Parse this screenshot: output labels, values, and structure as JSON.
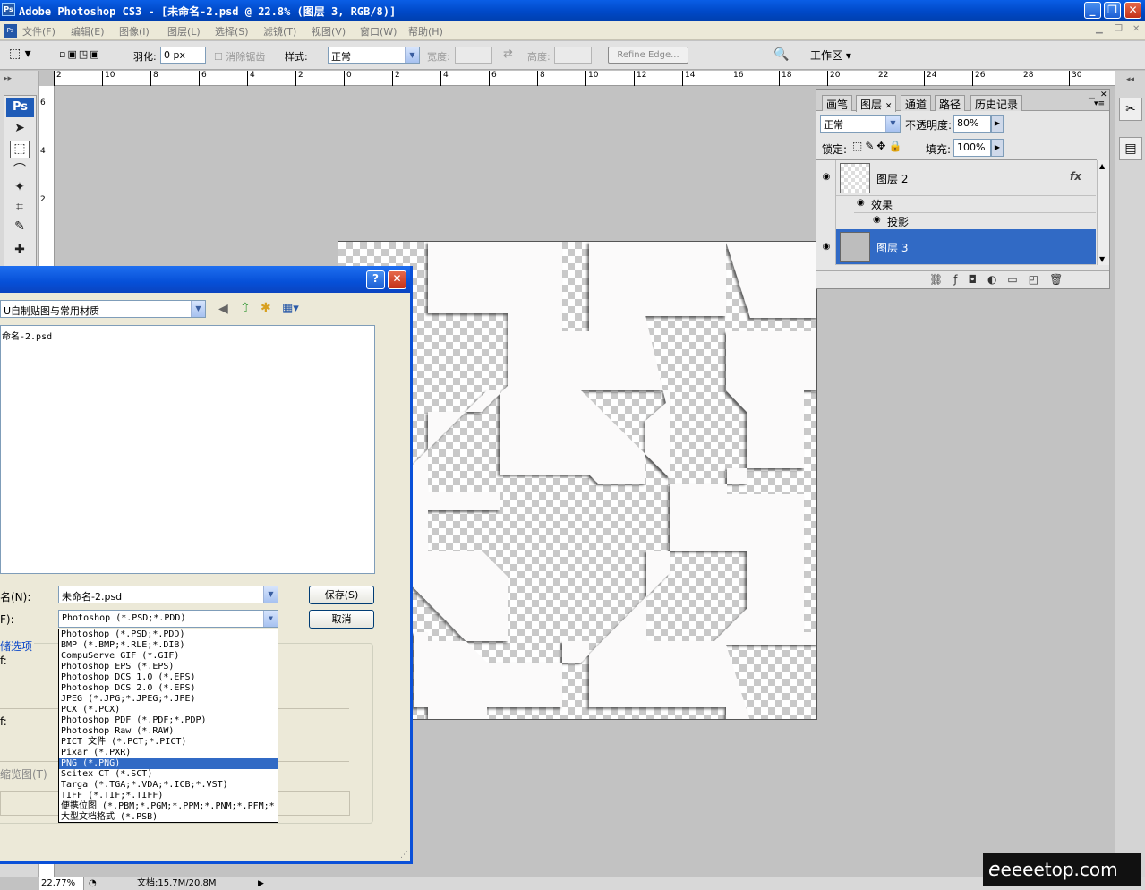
{
  "window": {
    "title": "Adobe Photoshop CS3 - [未命名-2.psd @ 22.8% (图层 3, RGB/8)]",
    "app_icon": "Ps"
  },
  "menu": {
    "items": [
      "文件(F)",
      "编辑(E)",
      "图像(I)",
      "图层(L)",
      "选择(S)",
      "滤镜(T)",
      "视图(V)",
      "窗口(W)",
      "帮助(H)"
    ]
  },
  "options": {
    "feather_label": "羽化:",
    "feather_value": "0 px",
    "antialias_label": "消除锯齿",
    "style_label": "样式:",
    "style_value": "正常",
    "width_label": "宽度:",
    "height_label": "高度:",
    "refine_edge": "Refine Edge...",
    "workspace": "工作区 ▾"
  },
  "ruler": {
    "top_ticks": [
      "2",
      "10",
      "8",
      "6",
      "4",
      "2",
      "0",
      "2",
      "4",
      "6",
      "8",
      "10",
      "12",
      "14",
      "16",
      "18",
      "20",
      "22",
      "24",
      "26",
      "28",
      "30"
    ],
    "left_ticks": [
      "6",
      "4",
      "2"
    ]
  },
  "layers_panel": {
    "tabs": [
      "画笔",
      "图层",
      "通道",
      "路径",
      "历史记录"
    ],
    "blend_mode": "正常",
    "opacity_label": "不透明度:",
    "opacity_value": "80%",
    "lock_label": "锁定:",
    "fill_label": "填充:",
    "fill_value": "100%",
    "layers": [
      {
        "name": "图层 2",
        "fx": "fx"
      },
      {
        "name": "效果"
      },
      {
        "name": "投影"
      },
      {
        "name": "图层 3"
      }
    ]
  },
  "dialog": {
    "help_btn": "?",
    "close_btn": "✕",
    "folder": "U自制贴图与常用材质",
    "files": [
      "命名-2.psd"
    ],
    "filename_label": "名(N):",
    "filename_value": "未命名-2.psd",
    "format_label": "F):",
    "format_value": "Photoshop (*.PSD;*.PDD)",
    "save_btn": "保存(S)",
    "cancel_btn": "取消",
    "options_label": "储选项",
    "side_label_1": "f:",
    "side_label_2": "f:",
    "thumb_label": "缩览图(T)",
    "format_options": [
      "Photoshop (*.PSD;*.PDD)",
      "BMP (*.BMP;*.RLE;*.DIB)",
      "CompuServe GIF (*.GIF)",
      "Photoshop EPS (*.EPS)",
      "Photoshop DCS 1.0 (*.EPS)",
      "Photoshop DCS 2.0 (*.EPS)",
      "JPEG (*.JPG;*.JPEG;*.JPE)",
      "PCX (*.PCX)",
      "Photoshop PDF (*.PDF;*.PDP)",
      "Photoshop Raw (*.RAW)",
      "PICT 文件 (*.PCT;*.PICT)",
      "Pixar (*.PXR)",
      "PNG (*.PNG)",
      "Scitex CT (*.SCT)",
      "Targa (*.TGA;*.VDA;*.ICB;*.VST)",
      "TIFF (*.TIF;*.TIFF)",
      "便携位图 (*.PBM;*.PGM;*.PPM;*.PNM;*.PFM;*",
      "大型文档格式 (*.PSB)"
    ],
    "highlighted_index": 12
  },
  "status": {
    "zoom": "22.77%",
    "doc": "文档:15.7M/20.8M"
  },
  "watermark": "eeeetop.com"
}
